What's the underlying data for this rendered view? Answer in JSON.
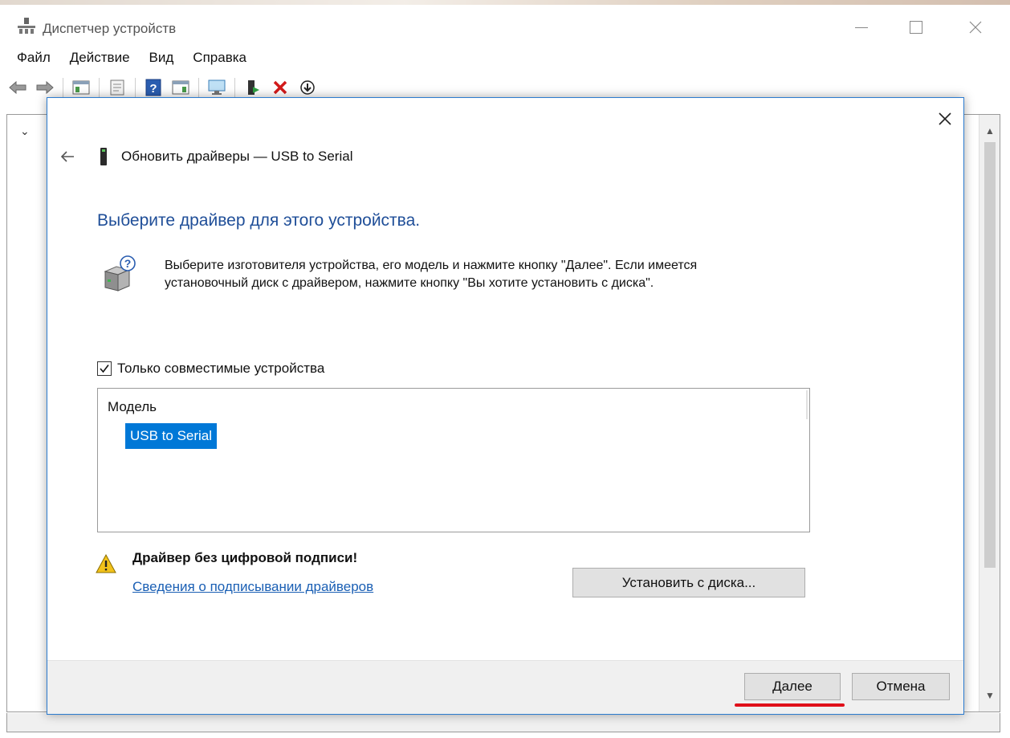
{
  "background_window": {
    "title": "Диспетчер устройств",
    "menu": [
      "Файл",
      "Действие",
      "Вид",
      "Справка"
    ]
  },
  "dialog": {
    "title": "Обновить драйверы — USB to Serial",
    "heading": "Выберите драйвер для этого устройства.",
    "info_line1": "Выберите изготовителя устройства, его модель и нажмите кнопку \"Далее\". Если имеется",
    "info_line2": "установочный диск с  драйвером, нажмите кнопку \"Вы хотите установить с диска\".",
    "compatible_checkbox": {
      "label": "Только совместимые устройства",
      "checked": true
    },
    "model_list": {
      "header": "Модель",
      "items": [
        "USB to Serial"
      ],
      "selected": "USB to Serial"
    },
    "warning_title": "Драйвер без цифровой подписи!",
    "warning_link": "Сведения о подписывании драйверов",
    "install_from_disk_button": "Установить с диска...",
    "next_button": "Далее",
    "cancel_button": "Отмена"
  },
  "colors": {
    "heading": "#1f4e98",
    "selection": "#0078d7",
    "link": "#1a5fb4",
    "highlight_underline": "#e0101a"
  }
}
